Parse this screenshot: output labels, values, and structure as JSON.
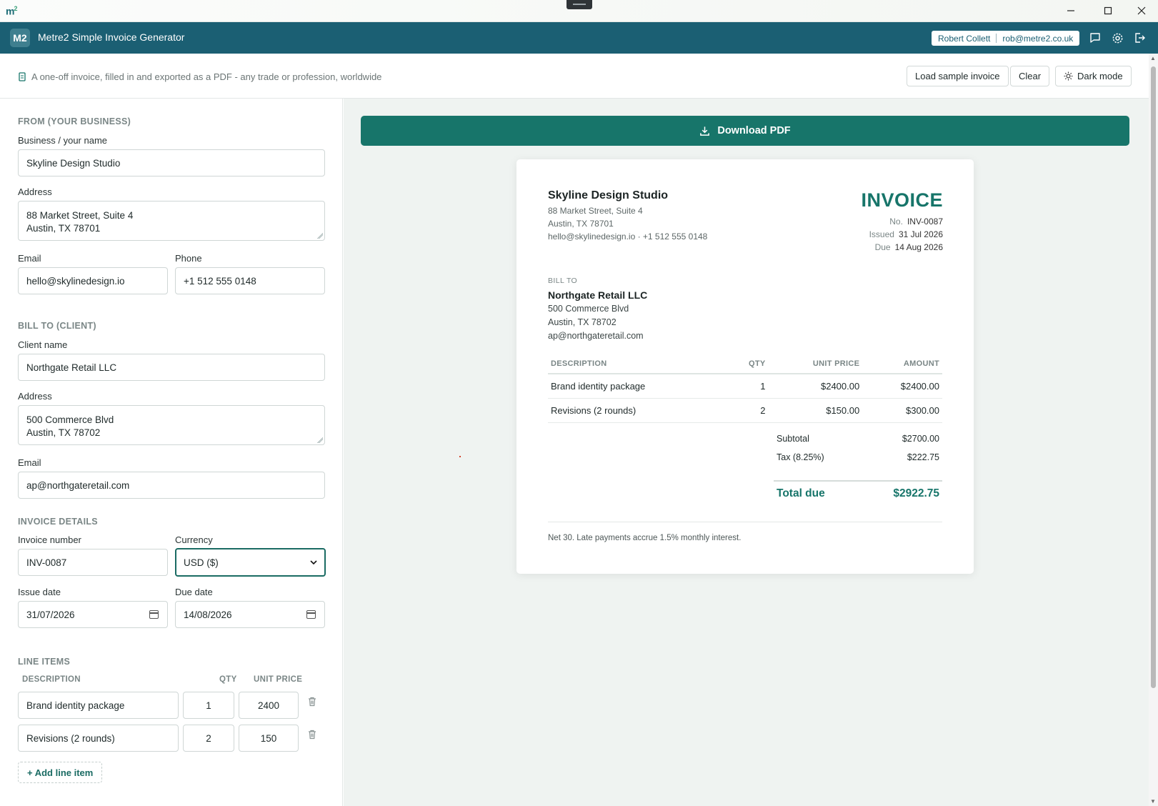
{
  "window": {
    "logo": "m",
    "logo_sup": "2"
  },
  "appbar": {
    "badge": "M2",
    "title": "Metre2 Simple Invoice Generator",
    "user_name": "Robert Collett",
    "user_email": "rob@metre2.co.uk",
    "icons": [
      "chat-icon",
      "gear-icon",
      "logout-icon"
    ]
  },
  "subbar": {
    "tagline": "A one-off invoice, filled in and exported as a PDF - any trade or profession, worldwide",
    "load_sample": "Load sample invoice",
    "clear": "Clear",
    "dark_mode": "Dark mode"
  },
  "form": {
    "from": {
      "section": "FROM (YOUR BUSINESS)",
      "name_label": "Business / your name",
      "name": "Skyline Design Studio",
      "address_label": "Address",
      "address": [
        "88 Market Street, Suite 4",
        "Austin, TX 78701"
      ],
      "email_label": "Email",
      "email": "hello@skylinedesign.io",
      "phone_label": "Phone",
      "phone": "+1 512 555 0148"
    },
    "bill_to": {
      "section": "BILL TO (CLIENT)",
      "name_label": "Client name",
      "name": "Northgate Retail LLC",
      "address_label": "Address",
      "address": [
        "500 Commerce Blvd",
        "Austin, TX 78702"
      ],
      "email_label": "Email",
      "email": "ap@northgateretail.com"
    },
    "details": {
      "section": "INVOICE DETAILS",
      "number_label": "Invoice number",
      "number": "INV-0087",
      "currency_label": "Currency",
      "currency": "USD ($)",
      "issue_label": "Issue date",
      "issue": "31/07/2026",
      "due_label": "Due date",
      "due": "14/08/2026"
    },
    "line_items": {
      "section": "LINE ITEMS",
      "col_desc": "DESCRIPTION",
      "col_qty": "QTY",
      "col_price": "UNIT PRICE",
      "items": [
        {
          "desc": "Brand identity package",
          "qty": "1",
          "price": "2400"
        },
        {
          "desc": "Revisions (2 rounds)",
          "qty": "2",
          "price": "150"
        }
      ],
      "add": "+ Add line item"
    }
  },
  "preview": {
    "download": "Download PDF",
    "biz_name": "Skyline Design Studio",
    "biz_addr1": "88 Market Street, Suite 4",
    "biz_addr2": "Austin, TX 78701",
    "biz_contact": "hello@skylinedesign.io · +1 512 555 0148",
    "heading": "INVOICE",
    "no_label": "No.",
    "no": "INV-0087",
    "issued_label": "Issued",
    "issued": "31 Jul 2026",
    "due_label": "Due",
    "due": "14 Aug 2026",
    "bill_to_label": "BILL TO",
    "client": "Northgate Retail LLC",
    "client_addr1": "500 Commerce Blvd",
    "client_addr2": "Austin, TX 78702",
    "client_email": "ap@northgateretail.com",
    "table_headers": [
      "DESCRIPTION",
      "QTY",
      "UNIT PRICE",
      "AMOUNT"
    ],
    "rows": [
      [
        "Brand identity package",
        "1",
        "$2400.00",
        "$2400.00"
      ],
      [
        "Revisions (2 rounds)",
        "2",
        "$150.00",
        "$300.00"
      ]
    ],
    "subtotal_label": "Subtotal",
    "subtotal": "$2700.00",
    "tax_label": "Tax (8.25%)",
    "tax": "$222.75",
    "total_label": "Total due",
    "total": "$2922.75",
    "note": "Net 30. Late payments accrue 1.5% monthly interest."
  },
  "colors": {
    "appbar": "#1b5f73",
    "accent": "#17756a"
  }
}
